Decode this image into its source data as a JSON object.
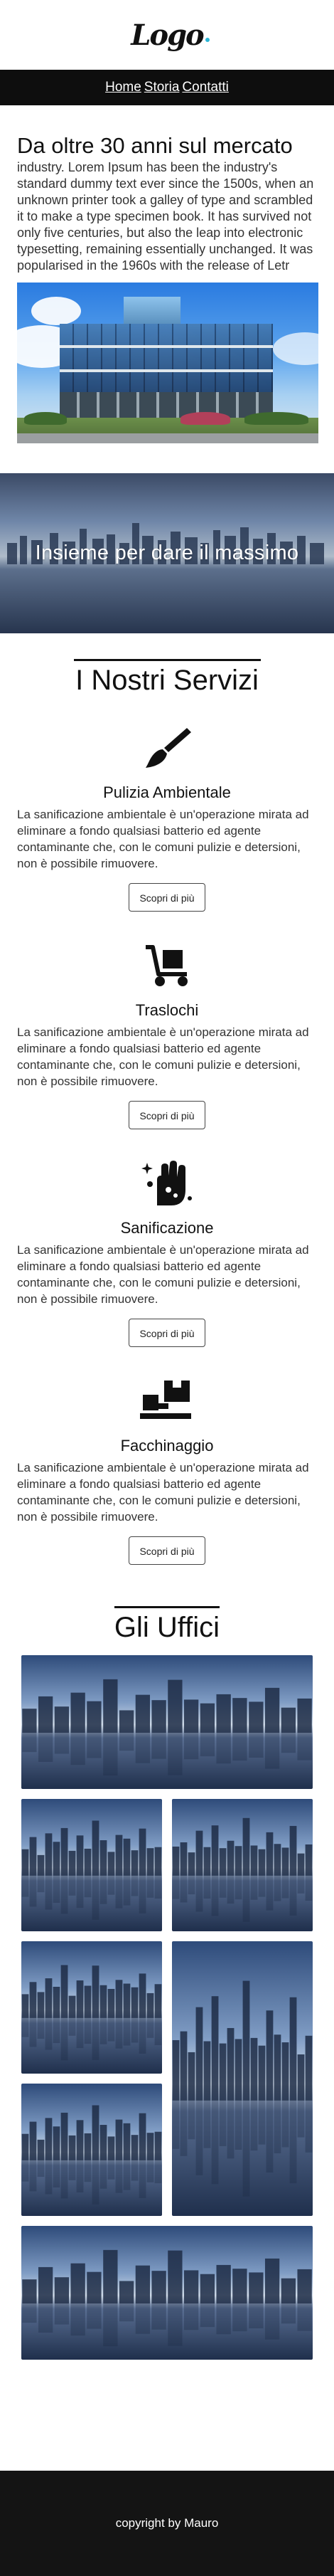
{
  "header": {
    "logo_text": "Logo"
  },
  "nav": {
    "items": [
      "Home",
      "Storia",
      "Contatti"
    ]
  },
  "about": {
    "title": "Da oltre 30 anni sul mercato",
    "body": "industry. Lorem Ipsum has been the industry's standard dummy text ever since the 1500s, when an unknown printer took a galley of type and scrambled it to make a type specimen book. It has survived not only five centuries, but also the leap into electronic typesetting, remaining essentially unchanged. It was popularised in the 1960s with the release of Letr"
  },
  "banner": {
    "text": "Insieme per dare il massimo"
  },
  "services": {
    "title": "I Nostri Servizi",
    "items": [
      {
        "icon": "brush-icon",
        "title": "Pulizia Ambientale",
        "text": "La sanificazione ambientale è un'operazione mirata ad eliminare a fondo qualsiasi batterio ed agente contaminante che, con le comuni pulizie e detersioni, non è possibile rimuovere.",
        "button": "Scopri di più"
      },
      {
        "icon": "hand-truck-icon",
        "title": "Traslochi",
        "text": "La sanificazione ambientale è un'operazione mirata ad eliminare a fondo qualsiasi batterio ed agente contaminante che, con le comuni pulizie e detersioni, non è possibile rimuovere.",
        "button": "Scopri di più"
      },
      {
        "icon": "sanitize-hand-icon",
        "title": "Sanificazione",
        "text": "La sanificazione ambientale è un'operazione mirata ad eliminare a fondo qualsiasi batterio ed agente contaminante che, con le comuni pulizie e detersioni, non è possibile rimuovere.",
        "button": "Scopri di più"
      },
      {
        "icon": "loading-boxes-icon",
        "title": "Facchinaggio",
        "text": "La sanificazione ambientale è un'operazione mirata ad eliminare a fondo qualsiasi batterio ed agente contaminante che, con le comuni pulizie e detersioni, non è possibile rimuovere.",
        "button": "Scopri di più"
      }
    ]
  },
  "offices": {
    "title": "Gli Uffici"
  },
  "footer": {
    "text": "copyright by Mauro"
  },
  "colors": {
    "nav_bg": "#0e0e0e",
    "footer_bg": "#141414",
    "logo_dot": "#2bb6d6"
  }
}
